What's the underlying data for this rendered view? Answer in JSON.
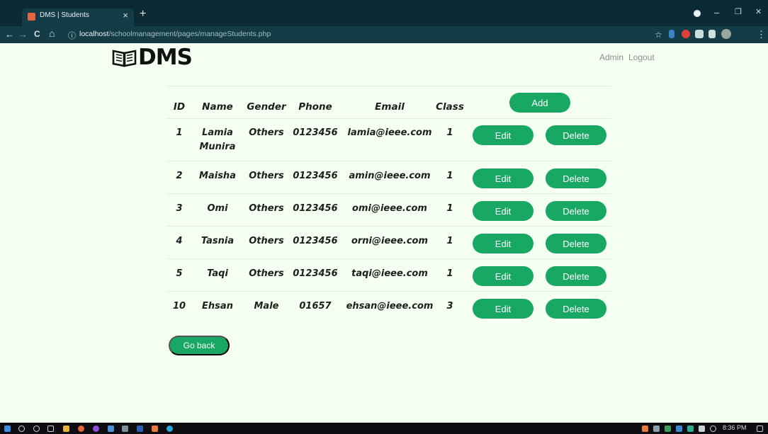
{
  "browser": {
    "tab_title": "DMS | Students",
    "tab_close": "×",
    "new_tab": "+",
    "back": "←",
    "forward": "→",
    "reload": "C",
    "home": "⌂",
    "info": "ⓘ",
    "url_host": "localhost",
    "url_path": "/schoolmanagement/pages/manageStudents.php",
    "star": "☆",
    "menu": "⋮",
    "minimize": "–",
    "restore": "❐",
    "close": "✕"
  },
  "header": {
    "logo_text": "DMS",
    "nav": [
      "Admin",
      "Logout"
    ]
  },
  "table": {
    "columns": [
      "ID",
      "Name",
      "Gender",
      "Phone",
      "Email",
      "Class"
    ],
    "add_label": "Add",
    "edit_label": "Edit",
    "delete_label": "Delete",
    "rows": [
      {
        "id": "1",
        "name": "Lamia Munira",
        "gender": "Others",
        "phone": "0123456",
        "email": "lamia@ieee.com",
        "class": "1"
      },
      {
        "id": "2",
        "name": "Maisha",
        "gender": "Others",
        "phone": "0123456",
        "email": "amin@ieee.com",
        "class": "1"
      },
      {
        "id": "3",
        "name": "Omi",
        "gender": "Others",
        "phone": "0123456",
        "email": "omi@ieee.com",
        "class": "1"
      },
      {
        "id": "4",
        "name": "Tasnia",
        "gender": "Others",
        "phone": "0123456",
        "email": "orni@ieee.com",
        "class": "1"
      },
      {
        "id": "5",
        "name": "Taqi",
        "gender": "Others",
        "phone": "0123456",
        "email": "taqi@ieee.com",
        "class": "1"
      },
      {
        "id": "10",
        "name": "Ehsan",
        "gender": "Male",
        "phone": "01657",
        "email": "ehsan@ieee.com",
        "class": "3"
      }
    ]
  },
  "footer": {
    "go_back_label": "Go back"
  },
  "taskbar": {
    "clock": "8:36 PM"
  },
  "colors": {
    "accent": "#19a863",
    "page_bg": "#f4fff1",
    "chrome_dark": "#0b2a33",
    "chrome_bar": "#143c47"
  }
}
